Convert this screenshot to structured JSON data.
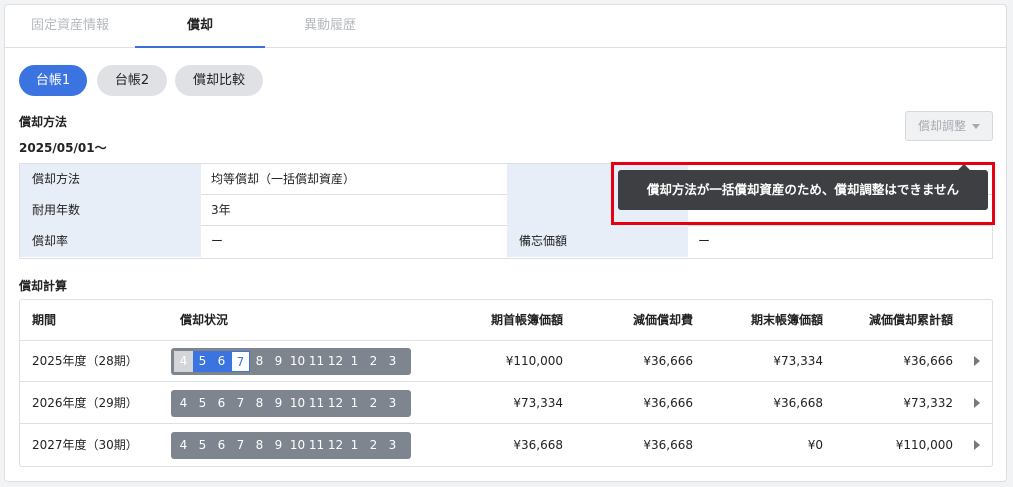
{
  "tabs": [
    "固定資産情報",
    "償却",
    "異動履歴"
  ],
  "ledgers": [
    "台帳1",
    "台帳2",
    "償却比較"
  ],
  "method_section": {
    "title": "償却方法",
    "start_date": "2025/05/01〜",
    "adjust_button": "償却調整",
    "rows": [
      {
        "label": "償却方法",
        "value": "均等償却（一括償却資産）",
        "label2": "",
        "value2": ""
      },
      {
        "label": "耐用年数",
        "value": "3年",
        "label2": "",
        "value2": ""
      },
      {
        "label": "償却率",
        "value": "ー",
        "label2": "備忘価額",
        "value2": "ー"
      }
    ],
    "tooltip": "償却方法が一括償却資産のため、償却調整はできません"
  },
  "calc_section": {
    "title": "償却計算",
    "headers": {
      "period": "期間",
      "status": "償却状況",
      "opening": "期首帳簿価額",
      "depreciation": "減価償却費",
      "closing": "期末帳簿価額",
      "accumulated": "減価償却累計額"
    },
    "rows": [
      {
        "period": "2025年度（28期）",
        "months": [
          {
            "m": "4",
            "state": "past"
          },
          {
            "m": "5",
            "state": "dep"
          },
          {
            "m": "6",
            "state": "dep"
          },
          {
            "m": "7",
            "state": "cur"
          },
          {
            "m": "8",
            "state": "none"
          },
          {
            "m": "9",
            "state": "none"
          },
          {
            "m": "10",
            "state": "none"
          },
          {
            "m": "11",
            "state": "none"
          },
          {
            "m": "12",
            "state": "none"
          },
          {
            "m": "1",
            "state": "none"
          },
          {
            "m": "2",
            "state": "none"
          },
          {
            "m": "3",
            "state": "none"
          }
        ],
        "opening": "¥110,000",
        "depreciation": "¥36,666",
        "closing": "¥73,334",
        "accumulated": "¥36,666"
      },
      {
        "period": "2026年度（29期）",
        "months": [
          {
            "m": "4",
            "state": "none"
          },
          {
            "m": "5",
            "state": "none"
          },
          {
            "m": "6",
            "state": "none"
          },
          {
            "m": "7",
            "state": "none"
          },
          {
            "m": "8",
            "state": "none"
          },
          {
            "m": "9",
            "state": "none"
          },
          {
            "m": "10",
            "state": "none"
          },
          {
            "m": "11",
            "state": "none"
          },
          {
            "m": "12",
            "state": "none"
          },
          {
            "m": "1",
            "state": "none"
          },
          {
            "m": "2",
            "state": "none"
          },
          {
            "m": "3",
            "state": "none"
          }
        ],
        "opening": "¥73,334",
        "depreciation": "¥36,666",
        "closing": "¥36,668",
        "accumulated": "¥73,332"
      },
      {
        "period": "2027年度（30期）",
        "months": [
          {
            "m": "4",
            "state": "none"
          },
          {
            "m": "5",
            "state": "none"
          },
          {
            "m": "6",
            "state": "none"
          },
          {
            "m": "7",
            "state": "none"
          },
          {
            "m": "8",
            "state": "none"
          },
          {
            "m": "9",
            "state": "none"
          },
          {
            "m": "10",
            "state": "none"
          },
          {
            "m": "11",
            "state": "none"
          },
          {
            "m": "12",
            "state": "none"
          },
          {
            "m": "1",
            "state": "none"
          },
          {
            "m": "2",
            "state": "none"
          },
          {
            "m": "3",
            "state": "none"
          }
        ],
        "opening": "¥36,668",
        "depreciation": "¥36,668",
        "closing": "¥0",
        "accumulated": "¥110,000"
      }
    ]
  },
  "colors": {
    "accent": "#3b73e0",
    "tooltip_bg": "#3d3f42",
    "highlight": "#e60012",
    "label_bg": "#e8eef8",
    "month_strip": "#7f858f"
  },
  "icons": {
    "dropdown": "caret-down-icon",
    "row_expand": "chevron-right-icon"
  }
}
